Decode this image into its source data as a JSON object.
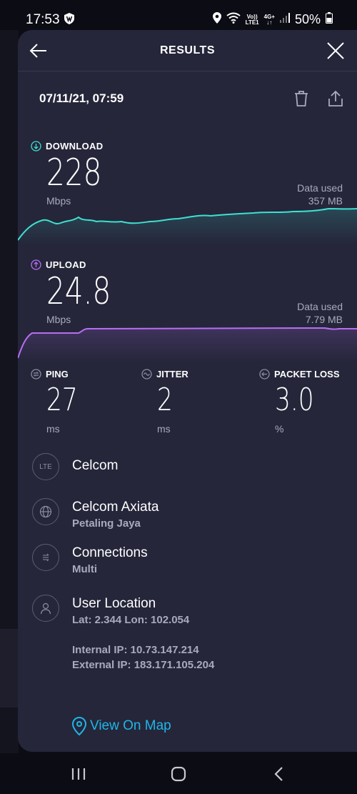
{
  "status_bar": {
    "time": "17:53",
    "network": "LTE1",
    "volte": "Vo))",
    "net_type": "4G+",
    "battery": "50%"
  },
  "header": {
    "title": "RESULTS"
  },
  "result": {
    "date": "07/11/21, 07:59"
  },
  "download": {
    "label": "DOWNLOAD",
    "value": "228",
    "unit": "Mbps",
    "data_used_label": "Data used",
    "data_used": "357 MB",
    "color": "#3ee0d0"
  },
  "upload": {
    "label": "UPLOAD",
    "value": "24.8",
    "unit": "Mbps",
    "data_used_label": "Data used",
    "data_used": "7.79 MB",
    "color": "#b86ef5"
  },
  "ping": {
    "label": "PING",
    "value": "27",
    "unit": "ms"
  },
  "jitter": {
    "label": "JITTER",
    "value": "2",
    "unit": "ms"
  },
  "packet_loss": {
    "label": "PACKET LOSS",
    "value": "3.0",
    "unit": "%"
  },
  "info": {
    "carrier": {
      "icon": "lte-icon",
      "badge": "LTE",
      "title": "Celcom"
    },
    "server": {
      "icon": "globe-icon",
      "title": "Celcom Axiata",
      "sub": "Petaling Jaya"
    },
    "connections": {
      "icon": "connections-icon",
      "title": "Connections",
      "sub": "Multi"
    },
    "location": {
      "icon": "user-icon",
      "title": "User Location",
      "sub": "Lat: 2.344 Lon: 102.054"
    },
    "internal_ip": "Internal IP: 10.73.147.214",
    "external_ip": "External IP: 183.171.105.204"
  },
  "map_link": {
    "label": "View On Map"
  },
  "colors": {
    "card_bg": "#25263a",
    "accent_link": "#1fb6e8",
    "muted_text": "#a9aabd"
  }
}
